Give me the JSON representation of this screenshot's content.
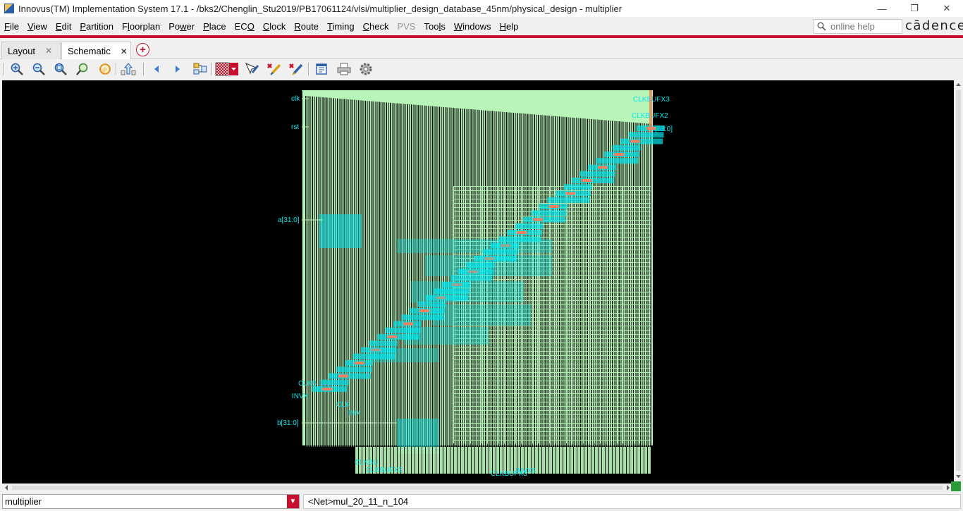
{
  "window": {
    "title": "Innovus(TM) Implementation System 17.1 - /bks2/Chenglin_Stu2019/PB17061124/vlsi/multiplier_design_database_45nm/physical_design - multiplier",
    "controls": {
      "minimize": "—",
      "restore": "❐",
      "close": "✕"
    }
  },
  "menubar": {
    "items": [
      {
        "pre": "",
        "u": "F",
        "post": "ile"
      },
      {
        "pre": "",
        "u": "V",
        "post": "iew"
      },
      {
        "pre": "",
        "u": "E",
        "post": "dit"
      },
      {
        "pre": "",
        "u": "P",
        "post": "artition"
      },
      {
        "pre": "F",
        "u": "l",
        "post": "oorplan"
      },
      {
        "pre": "Po",
        "u": "w",
        "post": "er"
      },
      {
        "pre": "",
        "u": "P",
        "post": "lace"
      },
      {
        "pre": "EC",
        "u": "O",
        "post": ""
      },
      {
        "pre": "",
        "u": "C",
        "post": "lock"
      },
      {
        "pre": "",
        "u": "R",
        "post": "oute"
      },
      {
        "pre": "",
        "u": "T",
        "post": "iming"
      },
      {
        "pre": "",
        "u": "C",
        "post": "heck"
      },
      {
        "pre": "PVS",
        "u": "",
        "post": ""
      },
      {
        "pre": "Too",
        "u": "l",
        "post": "s"
      },
      {
        "pre": "",
        "u": "W",
        "post": "indows"
      },
      {
        "pre": "",
        "u": "H",
        "post": "elp"
      }
    ],
    "help_placeholder": "online help",
    "brand": "cādence"
  },
  "tabs": {
    "items": [
      {
        "label": "Layout",
        "active": false
      },
      {
        "label": "Schematic",
        "active": true
      }
    ],
    "close_glyph": "✕",
    "add_glyph": "+"
  },
  "toolbar": {
    "icons": [
      "zoom-in-icon",
      "zoom-out-icon",
      "zoom-fit-icon",
      "zoom-selected-icon",
      "redraw-icon",
      "hierarchy-up-icon",
      "previous-icon",
      "next-icon",
      "schematic-group-icon",
      "display-filter-icon",
      "select-tool-icon",
      "highlight-icon",
      "clear-highlight-icon",
      "report-icon",
      "print-icon",
      "settings-icon"
    ]
  },
  "schematic": {
    "pins": {
      "clk": "clk",
      "rst": "rst",
      "a": "a[31:0]",
      "b": "b[31:0]",
      "out": "[63:0]"
    },
    "cells": {
      "top1": "CLKBUFX3",
      "top2": "CLKBUFX2",
      "bottom1": "CLKBUFX3",
      "bottom2": "INVX6",
      "left1": "INVX",
      "left2": "CLK",
      "left3": "INV",
      "mid1": "CLKB",
      "bot_left": "CLKBU",
      "bot_left2": "CLKBUFX3"
    },
    "colors": {
      "background": "#000000",
      "module": "#b8f5b8",
      "wire": "#00e5ee",
      "highlight": "#f08060"
    }
  },
  "status": {
    "design": "multiplier",
    "dropdown_glyph": "▼",
    "net_info": "<Net>mul_20_11_n_104"
  }
}
